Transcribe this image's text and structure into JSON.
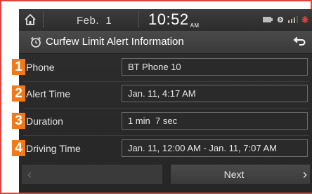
{
  "status": {
    "date": "Feb.  1",
    "time": "10:52",
    "ampm": "AM"
  },
  "header": {
    "title": "Curfew Limit Alert Information"
  },
  "rows": [
    {
      "number": "1",
      "label": "Phone",
      "value": "BT Phone 10"
    },
    {
      "number": "2",
      "label": "Alert Time",
      "value": "Jan. 11, 4:17 AM"
    },
    {
      "number": "3",
      "label": "Duration",
      "value": "1 min  7 sec"
    },
    {
      "number": "4",
      "label": "Driving Time",
      "value": "Jan. 11, 12:00 AM - Jan. 11, 7:07 AM"
    }
  ],
  "nav": {
    "prev_glyph": "‹",
    "next_label": "Next",
    "next_glyph": "›"
  },
  "colors": {
    "frame_border": "#e3413b",
    "callout_badge": "#f07a1a",
    "screen_bg": "#2e2e2e"
  }
}
